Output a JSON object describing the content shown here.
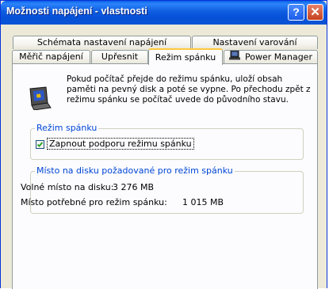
{
  "window": {
    "title": "Možnosti napájení - vlastnosti",
    "help_glyph": "?",
    "close_glyph": "✕"
  },
  "tabs_row1": [
    "Schémata nastavení napájení",
    "Nastavení varování"
  ],
  "tabs_row2": [
    "Měřič napájení",
    "Upřesnit",
    "Režim spánku",
    "Power Manager"
  ],
  "active_tab": "Režim spánku",
  "info": {
    "icon": "laptop-hibernate-icon",
    "text": "Pokud počítač přejde do režimu spánku, uloží obsah paměti na pevný disk a poté se vypne. Po přechodu zpět z režimu spánku se počítač uvede do původního stavu."
  },
  "sleep_group": {
    "label": "Režim spánku",
    "checkbox_label": "Zapnout podporu režimu spánku",
    "checked": true
  },
  "disk_group": {
    "label": "Místo na disku požadované pro režim spánku",
    "free_label": "Volné místo na disku:",
    "free_value": "3 276 MB",
    "required_label": "Místo potřebné pro režim spánku:",
    "required_value": "1 015 MB"
  },
  "colors": {
    "title_bar": "#0A53D4",
    "group_label": "#0046D5",
    "tab_highlight": "#FFC83C"
  }
}
